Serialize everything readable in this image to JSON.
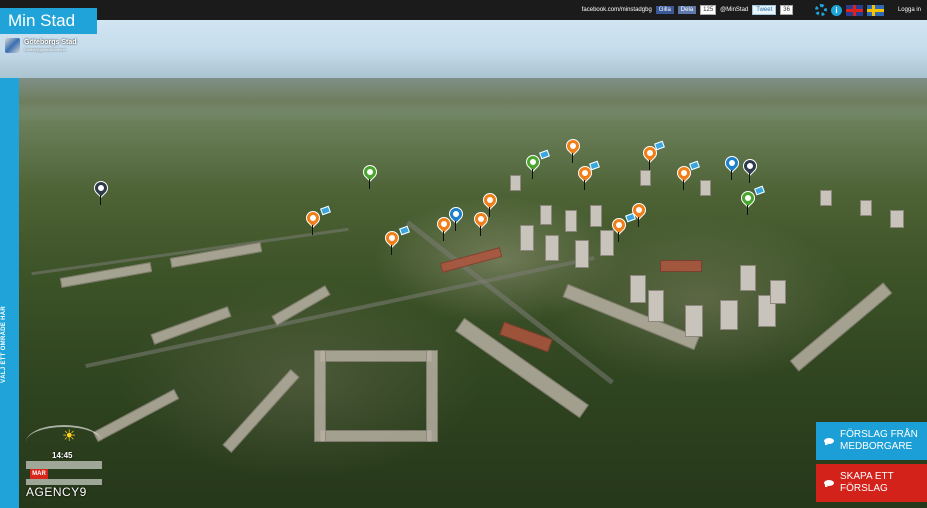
{
  "header": {
    "app_title": "Min Stad",
    "facebook_url_text": "facebook.com/minstadgbg",
    "fb_like_label": "Gilla",
    "fb_share_label": "Dela",
    "fb_count": "125",
    "twitter_handle": "@MinStad",
    "tweet_label": "Tweet",
    "tweet_count": "36",
    "login_label": "Logga in"
  },
  "city": {
    "name": "Göteborgs Stad",
    "subtitle": "Stadsbyggnadskontoret"
  },
  "sidebar": {
    "vertical_label": "VÄLJ ETT OMRÅDE HÄR"
  },
  "clock": {
    "time": "14:45",
    "month": "MAR",
    "brand": "AGENCY9"
  },
  "cta": {
    "proposals_from_citizens": "FÖRSLAG FRÅN\nMEDBORGARE",
    "create_proposal": "SKAPA ETT\nFÖRSLAG"
  },
  "colors": {
    "accent_blue": "#1fa3d8",
    "accent_red": "#d3221a",
    "pin_orange": "#f07f1a",
    "pin_blue": "#1e7fc8",
    "pin_green": "#4aa52e"
  },
  "map_pins": [
    {
      "type": "orange",
      "icon": "location-pin-icon"
    },
    {
      "type": "blue",
      "icon": "location-pin-icon"
    },
    {
      "type": "green",
      "icon": "location-pin-icon"
    },
    {
      "type": "dark",
      "icon": "location-pin-icon"
    }
  ]
}
